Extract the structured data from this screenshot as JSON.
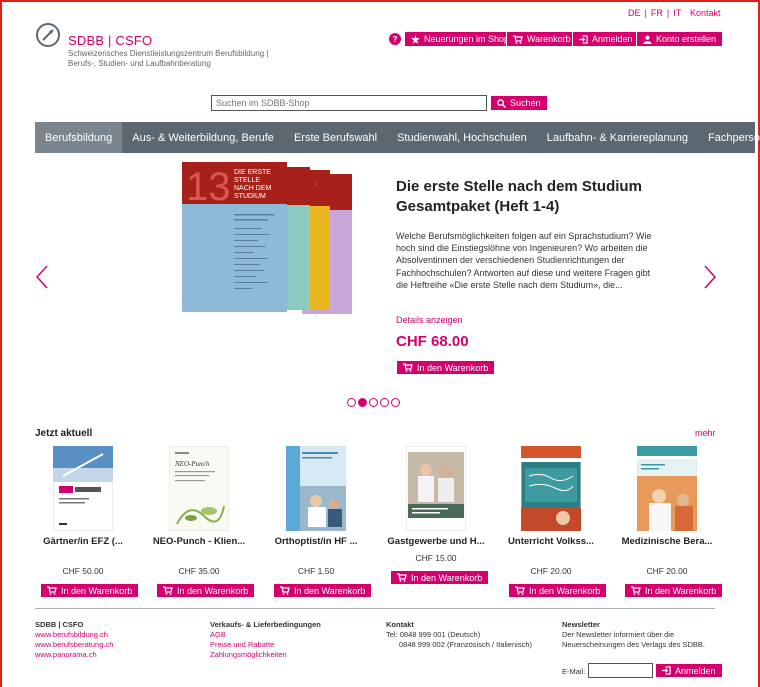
{
  "top_links": {
    "de": "DE",
    "fr": "FR",
    "it": "IT",
    "sep": "|",
    "kontakt": "Kontakt"
  },
  "logo": {
    "name": "SDBB | CSFO",
    "subtitle": "Schweizerisches Dienstleistungszentrum Berufsbildung | Berufs-, Studien- und Laufbahnberatung"
  },
  "header": {
    "help": "?",
    "news": "Neuerungen im Shop",
    "cart": "Warenkorb",
    "login": "Anmelden",
    "register": "Konto erstellen"
  },
  "search": {
    "placeholder": "Suchen im SDBB-Shop",
    "button": "Suchen"
  },
  "nav": [
    "Berufsbildung",
    "Aus- & Weiterbildung, Berufe",
    "Erste Berufswahl",
    "Studienwahl, Hochschulen",
    "Laufbahn- & Karriereplanung",
    "Fachpersonen"
  ],
  "hero": {
    "book_number": "13",
    "book_title_lines": [
      "DIE ERSTE",
      "STELLE",
      "NACH DEM",
      "STUDIUM"
    ],
    "title": "Die erste Stelle nach dem Studium Gesamtpaket (Heft 1-4)",
    "description": "Welche Berufsmöglichkeiten folgen auf ein Sprachstudium? Wie hoch sind die Einstiegslöhne von Ingenieuren? Wo arbeiten die Absolventinnen der verschiedenen Studienrichtungen der Fachhochschulen? Antworten auf diese und weitere Fragen gibt die Heftreihe «Die erste Stelle nach dem Studium», die...",
    "details_link": "Details anzeigen",
    "price": "CHF 68.00",
    "cart_button": "In den Warenkorb",
    "slide_count": 5,
    "active_slide": 2
  },
  "section": {
    "title": "Jetzt aktuell",
    "more": "mehr"
  },
  "products": [
    {
      "name": "Gärtner/in EFZ (...",
      "price": "CHF 50.00",
      "cart": "In den Warenkorb"
    },
    {
      "name": "NEO-Punch - Klien...",
      "price": "CHF 35.00",
      "cart": "In den Warenkorb"
    },
    {
      "name": "Orthoptist/in HF ...",
      "price": "CHF 1.50",
      "cart": "In den Warenkorb"
    },
    {
      "name": "Gastgewerbe und H...",
      "price": "CHF 15.00",
      "cart": "In den Warenkorb"
    },
    {
      "name": "Unterricht Volkss...",
      "price": "CHF 20.00",
      "cart": "In den Warenkorb"
    },
    {
      "name": "Medizinische Bera...",
      "price": "CHF 20.00",
      "cart": "In den Warenkorb"
    }
  ],
  "footer": {
    "col1": {
      "heading": "SDBB | CSFO",
      "links": [
        "www.berufsbildung.ch",
        "www.berufsberatung.ch",
        "www.panorama.ch"
      ]
    },
    "col2": {
      "heading": "Verkaufs- & Lieferbedingungen",
      "links": [
        "AGB",
        "Preise und Rabatte",
        "Zahlungsmöglichkeiten"
      ]
    },
    "col3": {
      "heading": "Kontakt",
      "line1": "Tel: 0848 999 001 (Deutsch)",
      "line2": "0848 999 002 (Französisch / Italienisch)"
    },
    "col4": {
      "heading": "Newsletter",
      "text": "Der Newsletter informiert über die Neuerscheinungen des Verlags des SDBB.",
      "email_label": "E-Mail:",
      "button": "Anmelden"
    }
  },
  "colors": {
    "accent": "#d4006e",
    "nav_bg": "#5b6771",
    "nav_active": "#7a858e",
    "frame": "#e0201b"
  }
}
